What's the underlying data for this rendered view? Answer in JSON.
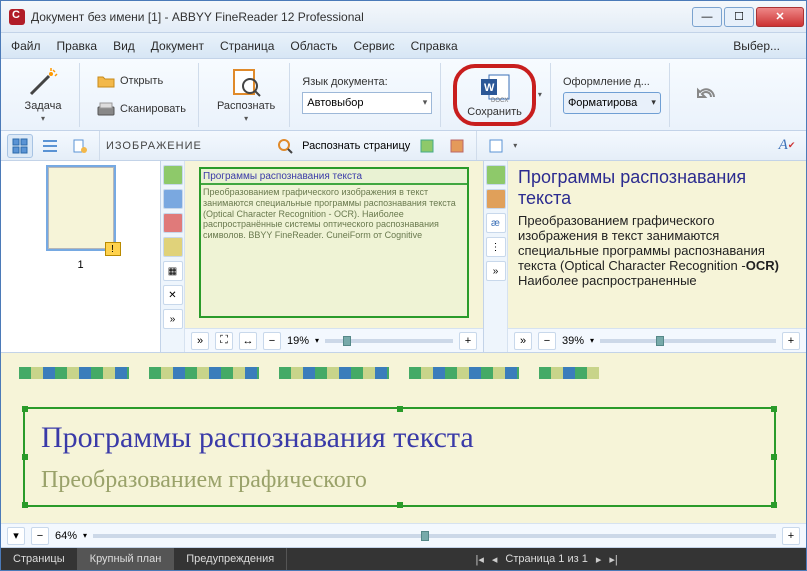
{
  "title": "Документ без имени [1] - ABBYY FineReader 12 Professional",
  "menu": {
    "file": "Файл",
    "edit": "Правка",
    "view": "Вид",
    "document": "Документ",
    "page": "Страница",
    "area": "Область",
    "tools": "Сервис",
    "help": "Справка",
    "picker": "Выбер..."
  },
  "ribbon": {
    "task": "Задача",
    "open": "Открыть",
    "scan": "Сканировать",
    "recognize": "Распознать",
    "lang_label": "Язык документа:",
    "lang_value": "Автовыбор",
    "save": "Сохранить",
    "design_label": "Оформление д...",
    "format_value": "Форматирова"
  },
  "image_panel": {
    "title": "ИЗОБРАЖЕНИЕ",
    "recognize_page": "Распознать страницу",
    "zoom": "19%",
    "preview_title": "Программы распознавания текста",
    "preview_lines": "Преобразованием графического изображения в текст занимаются специальные программы распознавания текста (Optical Character Recognition - OCR). Наиболее распространённые системы оптического распознавания символов. BBYY FineReader. CuneiForm от Cognitive"
  },
  "text_panel": {
    "zoom": "39%",
    "heading": "Программы распознавания текста",
    "body": "Преобразованием графического изображения в текст занимаются специальные программы распознавания текста (Optical Character Recognition -",
    "bold": "OCR",
    "bold_paren": ")",
    "cont": "Наиболее распространенные"
  },
  "closeup": {
    "zoom": "64%",
    "heading": "Программы распознавания текста",
    "sub": "Преобразованием графического"
  },
  "status": {
    "pages": "Страницы",
    "closeup": "Крупный план",
    "warnings": "Предупреждения",
    "page_info": "Страница 1 из 1"
  },
  "thumb_num": "1"
}
